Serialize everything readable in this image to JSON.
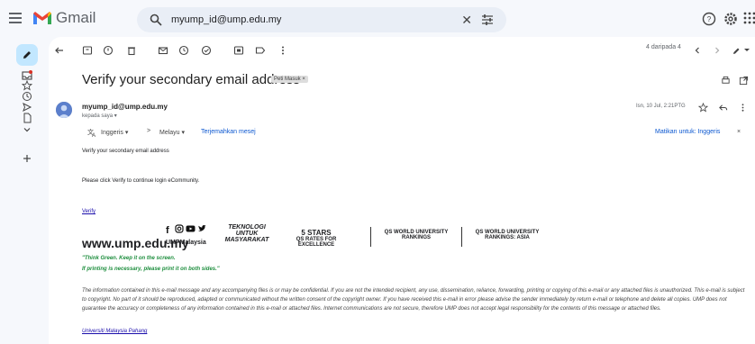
{
  "app": {
    "name": "Gmail"
  },
  "search": {
    "value": "myump_id@ump.edu.my"
  },
  "toolbar": {
    "pager": "4 daripada 4"
  },
  "email": {
    "subject": "Verify your secondary email address",
    "label": "Peti Masuk ×",
    "sender": "myump_id@ump.edu.my",
    "to": "kepada saya ▾",
    "date": "Isn, 10 Jul, 2:21PTG",
    "translate": {
      "from_lang": "Inggeris ▾",
      "arrow": ">",
      "to_lang": "Melayu ▾",
      "translate_link": "Terjemahkan mesej",
      "turn_off": "Matikan untuk: Inggeris",
      "close": "×"
    },
    "body": {
      "line1": "Verify your secondary email address",
      "line2": "Please click Verify to continue login eCommunity.",
      "verify_link": "Verify"
    },
    "signature": {
      "website": "www.ump.edu.my",
      "social_handle": "UMPMalaysia",
      "tagline_1": "TEKNOLOGI",
      "tagline_2": "UNTUK",
      "tagline_3": "MASYARAKAT",
      "stars_1": "5 STARS",
      "stars_2": "QS RATES FOR EXCELLENCE",
      "qs1_1": "QS WORLD UNIVERSITY",
      "qs1_2": "RANKINGS",
      "qs2_1": "QS WORLD UNIVERSITY",
      "qs2_2": "RANKINGS: ASIA"
    },
    "green_1": "\"Think Green. Keep it on the screen.",
    "green_2": "If printing is necessary, please print it on both sides.\"",
    "disclaimer": "The information contained in this e-mail message and any accompanying files is or may be confidential. If you are not the intended recipient, any use, dissemination, reliance, forwarding, printing or copying of this e-mail or any attached files is unauthorized. This e-mail is subject to copyright. No part of it should be reproduced, adapted or communicated without the written consent of the copyright owner. If you have received this e-mail in error please advise the sender immediately by return e-mail or telephone and delete all copies. UMP does not guarantee the accuracy or completeness of any information contained in this e-mail or attached files. Internet communications are not secure, therefore UMP does not accept legal responsibility for the contents of this message or attached files.",
    "footer_link": "Universiti Malaysia Pahang"
  },
  "icons": {
    "menu": "menu-icon",
    "search": "search-icon",
    "clear": "close-icon",
    "tune": "tune-icon",
    "help": "help-icon",
    "settings": "gear-icon",
    "apps": "apps-icon",
    "compose": "pencil-icon"
  },
  "colors": {
    "accent": "#0b57d0",
    "compose_bg": "#c2e7ff",
    "green": "#1e8e3e"
  }
}
